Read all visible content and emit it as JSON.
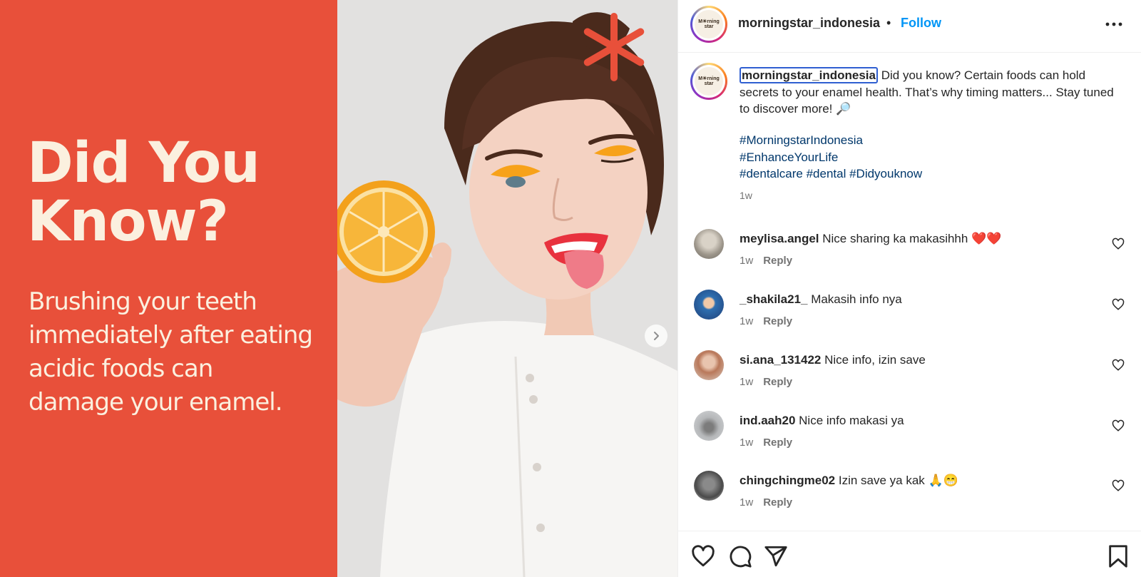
{
  "post_image": {
    "headline_line1": "Did You",
    "headline_line2": "Know?",
    "subtext": "Brushing your teeth immediately after eating acidic foods can damage your enamel.",
    "accent_color": "#e8503a",
    "logo_lines": [
      "M☀rning",
      "star"
    ]
  },
  "header": {
    "username": "morningstar_indonesia",
    "dot": "•",
    "follow_label": "Follow",
    "more_icon": "more-horizontal-icon"
  },
  "caption": {
    "username": "morningstar_indonesia",
    "text": " Did you know? Certain foods can hold secrets to your enamel health. That’s why timing matters... Stay tuned to discover more! 🔎",
    "hashtags": [
      "#MorningstarIndonesia",
      "#EnhanceYourLife",
      "#dentalcare",
      "#dental",
      "#Didyouknow"
    ],
    "time": "1w"
  },
  "comments": [
    {
      "username": "meylisa.angel",
      "text": " Nice sharing ka makasihhh ❤️❤️",
      "time": "1w",
      "reply": "Reply"
    },
    {
      "username": "_shakila21_",
      "text": " Makasih info nya",
      "time": "1w",
      "reply": "Reply"
    },
    {
      "username": "si.ana_131422",
      "text": " Nice info, izin save",
      "time": "1w",
      "reply": "Reply"
    },
    {
      "username": "ind.aah20",
      "text": " Nice info makasi ya",
      "time": "1w",
      "reply": "Reply"
    },
    {
      "username": "chingchingme02",
      "text": " Izin save ya kak 🙏😁",
      "time": "1w",
      "reply": "Reply"
    }
  ],
  "actions": {
    "icons": [
      "heart-icon",
      "comment-icon",
      "share-icon",
      "bookmark-icon"
    ]
  }
}
